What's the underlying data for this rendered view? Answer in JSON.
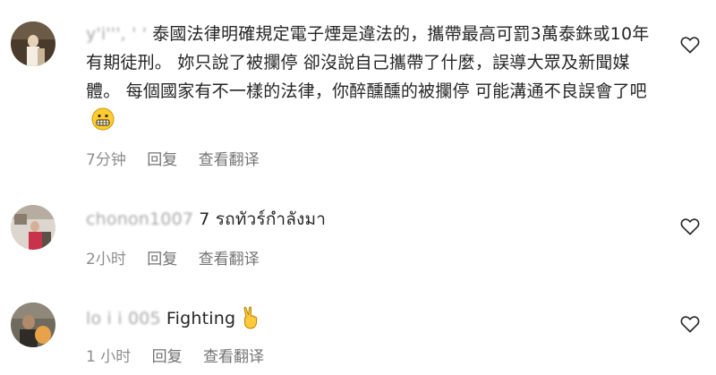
{
  "comments": [
    {
      "username": "y'i''',  '  '",
      "text": "泰國法律明確規定電子煙是違法的，攜帶最高可罰3萬泰銖或10年有期徒刑。 妳只說了被攔停 卻沒說自己攜帶了什麼，誤導大眾及新聞媒體。 每個國家有不一樣的法律，你醉醺醺的被攔停 可能溝通不良誤會了吧",
      "emoji": "grimacing-face",
      "time": "7分钟",
      "reply_label": "回复",
      "translate_label": "查看翻译"
    },
    {
      "username": "chonon1007",
      "text": "7 รถทัวร์กำลังมา",
      "time": "2小时",
      "reply_label": "回复",
      "translate_label": "查看翻译"
    },
    {
      "username": "lo  i   i  005",
      "text": "Fighting",
      "emoji": "victory-hand",
      "time": "1 小时",
      "reply_label": "回复",
      "translate_label": "查看翻译"
    }
  ]
}
